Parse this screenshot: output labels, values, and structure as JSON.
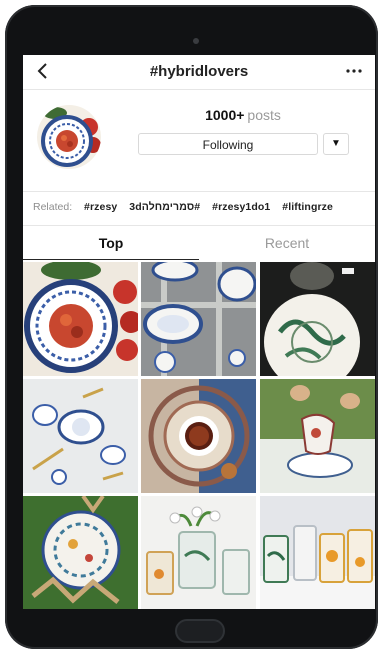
{
  "header": {
    "title": "#hybridlovers"
  },
  "profile": {
    "count": "1000+",
    "count_label": "posts",
    "follow_label": "Following"
  },
  "related": {
    "label": "Related:",
    "tags": [
      "#rzesy",
      "3dסמרימחלה#",
      "#rzesy1do1",
      "#liftingrze"
    ]
  },
  "tabs": {
    "top": "Top",
    "recent": "Recent"
  },
  "colors": {
    "accent": "#262626",
    "muted": "#9a9a9a",
    "bezel": "#111214"
  },
  "icons": [
    "back-arrow-icon",
    "more-options-icon",
    "dropdown-arrow-icon"
  ]
}
